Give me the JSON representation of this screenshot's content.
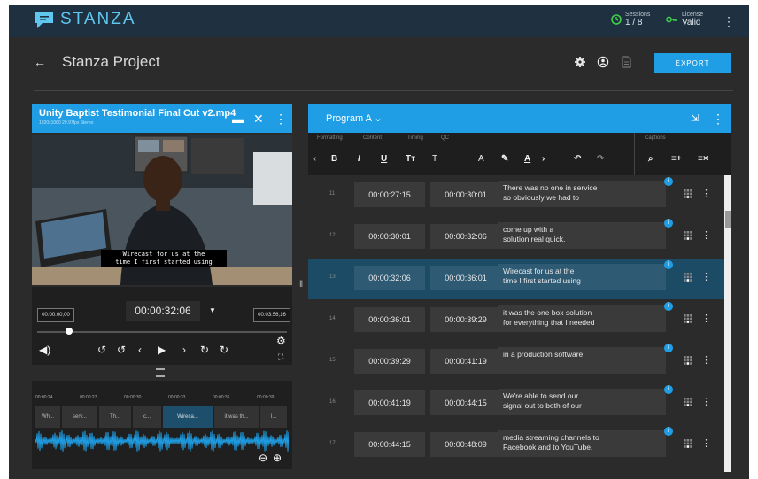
{
  "app": {
    "brand": "STANZA",
    "sessions_label": "Sessions",
    "sessions_value": "1 / 8",
    "license_label": "License",
    "license_value": "Valid"
  },
  "project": {
    "title": "Stanza Project",
    "export_label": "EXPORT"
  },
  "media": {
    "filename": "Unity Baptist Testimonial Final Cut v2.mp4",
    "details": "1920x1080 29.97fps Stereo",
    "caption_line1": "Wirecast for us at the",
    "caption_line2": "time I first started using",
    "current_timecode": "00:00:32:06",
    "start_timecode": "00:00:00;00",
    "end_timecode": "00:03:56;16",
    "progress": 0.14
  },
  "timeline": {
    "ticks": [
      "00:00:24",
      "00:00:27",
      "00:00:30",
      "00:00:33",
      "00:00:36",
      "00:00:39"
    ],
    "clips": [
      "Wh...",
      "serv...",
      "Th...",
      "c...",
      "Wireca...",
      "it was th...",
      "I..."
    ]
  },
  "program": {
    "name": "Program A",
    "tabs": [
      "Formatting",
      "Content",
      "Timing",
      "QC"
    ],
    "captions_tab": "Captions"
  },
  "captions": [
    {
      "num": "11",
      "in": "00:00:27:15",
      "out": "00:00:30:01",
      "line1": "There was no one in service",
      "line2": "so obviously we had to",
      "selected": false
    },
    {
      "num": "12",
      "in": "00:00:30:01",
      "out": "00:00:32:06",
      "line1": "come up with a",
      "line2": "solution real quick.",
      "selected": false
    },
    {
      "num": "13",
      "in": "00:00:32:06",
      "out": "00:00:36:01",
      "line1": "Wirecast for us at the",
      "line2": "time I first started using",
      "selected": true
    },
    {
      "num": "14",
      "in": "00:00:36:01",
      "out": "00:00:39:29",
      "line1": "it was the one box solution",
      "line2": "for everything that I needed",
      "selected": false
    },
    {
      "num": "15",
      "in": "00:00:39:29",
      "out": "00:00:41:19",
      "line1": "in a production software.",
      "line2": "",
      "selected": false
    },
    {
      "num": "16",
      "in": "00:00:41:19",
      "out": "00:00:44:15",
      "line1": "We're able to send our",
      "line2": "signal out to both of our",
      "selected": false
    },
    {
      "num": "17",
      "in": "00:00:44:15",
      "out": "00:00:48:09",
      "line1": "media streaming channels to",
      "line2": "Facebook and to YouTube.",
      "selected": false
    }
  ],
  "colors": {
    "accent": "#1f9ee5",
    "topbar": "#1f3140",
    "selected_row": "#1c4b66"
  }
}
